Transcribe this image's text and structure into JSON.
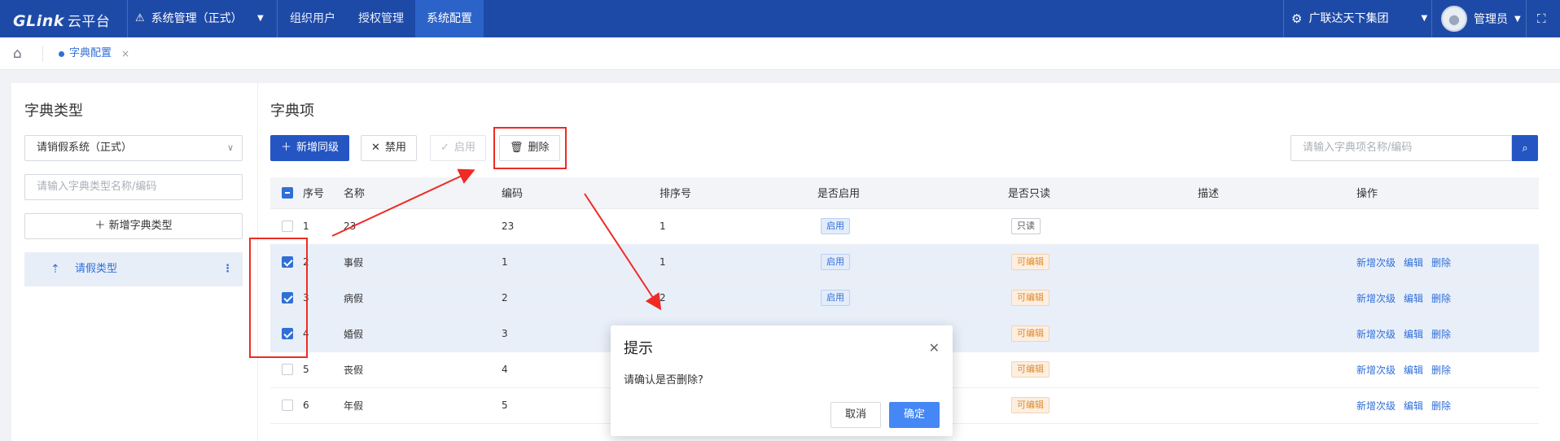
{
  "topbar": {
    "logo": "GLink",
    "logo_sub": "云平台",
    "system": "系统管理（正式）",
    "nav": [
      "组织用户",
      "授权管理",
      "系统配置"
    ],
    "active_nav": "系统配置",
    "org": "广联达天下集团",
    "user": "管理员"
  },
  "tabs": {
    "current": "字典配置"
  },
  "left": {
    "title": "字典类型",
    "select_value": "请销假系统（正式）",
    "search_placeholder": "请输入字典类型名称/编码",
    "add_button": "新增字典类型",
    "tree_item": "请假类型"
  },
  "right": {
    "title": "字典项",
    "buttons": {
      "add": "新增同级",
      "disable": "禁用",
      "enable": "启用",
      "delete": "删除"
    },
    "search_placeholder": "请输入字典项名称/编码",
    "columns": [
      "序号",
      "名称",
      "编码",
      "排序号",
      "是否启用",
      "是否只读",
      "描述",
      "操作"
    ],
    "rows": [
      {
        "no": "1",
        "name": "23",
        "code": "23",
        "sort": "1",
        "enabled": "启用",
        "readonly": "只读",
        "desc": "",
        "checked": false
      },
      {
        "no": "2",
        "name": "事假",
        "code": "1",
        "sort": "1",
        "enabled": "启用",
        "readonly": "可编辑",
        "desc": "",
        "checked": true
      },
      {
        "no": "3",
        "name": "病假",
        "code": "2",
        "sort": "2",
        "enabled": "启用",
        "readonly": "可编辑",
        "desc": "",
        "checked": true
      },
      {
        "no": "4",
        "name": "婚假",
        "code": "3",
        "sort": "",
        "enabled": "",
        "readonly": "可编辑",
        "desc": "",
        "checked": true
      },
      {
        "no": "5",
        "name": "丧假",
        "code": "4",
        "sort": "",
        "enabled": "",
        "readonly": "可编辑",
        "desc": "",
        "checked": false
      },
      {
        "no": "6",
        "name": "年假",
        "code": "5",
        "sort": "",
        "enabled": "",
        "readonly": "可编辑",
        "desc": "",
        "checked": false
      }
    ],
    "row_actions": [
      "新增次级",
      "编辑",
      "删除"
    ]
  },
  "modal": {
    "title": "提示",
    "message": "请确认是否删除?",
    "cancel": "取消",
    "ok": "确定"
  },
  "colors": {
    "topbar": "#1e4aa7",
    "primary": "#2455c3",
    "annotation": "#ee2b24"
  }
}
